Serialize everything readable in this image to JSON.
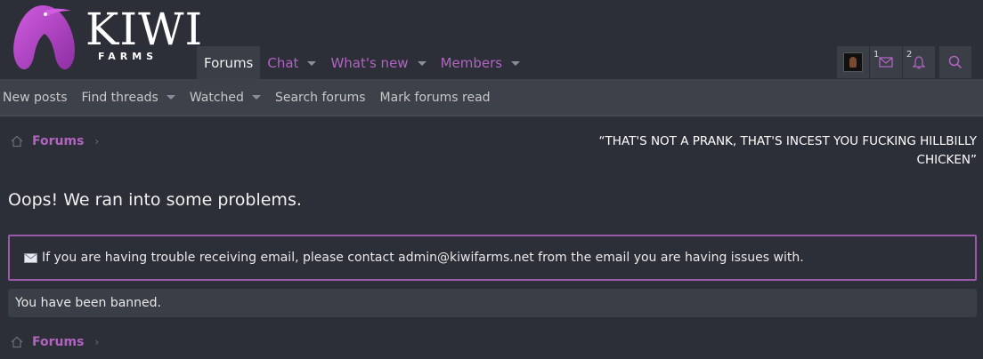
{
  "logo": {
    "title": "KIWI",
    "subtitle": "FARMS"
  },
  "nav": {
    "tabs": [
      {
        "label": "Forums",
        "active": true,
        "has_dropdown": false
      },
      {
        "label": "Chat",
        "active": false,
        "has_dropdown": true
      },
      {
        "label": "What's new",
        "active": false,
        "has_dropdown": true
      },
      {
        "label": "Members",
        "active": false,
        "has_dropdown": true
      }
    ]
  },
  "user_area": {
    "avatar_icon": "avatar-icon",
    "conversations_count": "1",
    "alerts_count": "2"
  },
  "subnav": {
    "items": [
      {
        "label": "New posts",
        "has_dropdown": false
      },
      {
        "label": "Find threads",
        "has_dropdown": true
      },
      {
        "label": "Watched",
        "has_dropdown": true
      },
      {
        "label": "Search forums",
        "has_dropdown": false
      },
      {
        "label": "Mark forums read",
        "has_dropdown": false
      }
    ]
  },
  "breadcrumb": {
    "label": "Forums"
  },
  "quote": "“THAT'S NOT A PRANK, THAT'S INCEST YOU FUCKING HILLBILLY CHICKEN”",
  "page_title": "Oops! We ran into some problems.",
  "notice": {
    "icon": "envelope-icon",
    "text": "If you are having trouble receiving email, please contact admin@kiwifarms.net from the email you are having issues with."
  },
  "error_message": "You have been banned.",
  "colors": {
    "background": "#2c2f37",
    "accent": "#b064c0",
    "notice_border": "#9b5aa8",
    "subnav_bg": "#3d4149"
  }
}
